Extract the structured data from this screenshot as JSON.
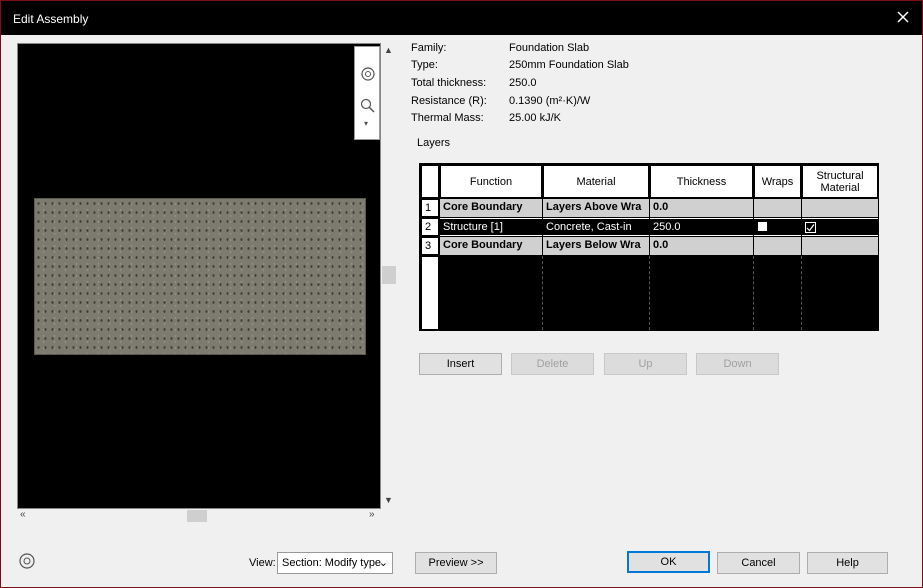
{
  "window": {
    "title": "Edit Assembly",
    "close_label": "×"
  },
  "properties": [
    {
      "label": "Family:",
      "value": "Foundation Slab"
    },
    {
      "label": "Type:",
      "value": "250mm Foundation Slab"
    },
    {
      "label": "Total thickness:",
      "value": "250.0"
    },
    {
      "label": "Resistance (R):",
      "value": "0.1390 (m²·K)/W"
    },
    {
      "label": "Thermal Mass:",
      "value": "25.00 kJ/K"
    }
  ],
  "layers": {
    "label": "Layers",
    "columns": [
      "Function",
      "Material",
      "Thickness",
      "Wraps",
      "Structural Material"
    ],
    "rows": [
      {
        "num": "1",
        "function": "Core Boundary",
        "material": "Layers Above Wra",
        "thickness": "0.0",
        "wraps": false,
        "structural": false,
        "style": "gray"
      },
      {
        "num": "2",
        "function": "Structure [1]",
        "material": "Concrete, Cast-in",
        "thickness": "250.0",
        "wraps": false,
        "structural": true,
        "style": "selected"
      },
      {
        "num": "3",
        "function": "Core Boundary",
        "material": "Layers Below Wra",
        "thickness": "0.0",
        "wraps": false,
        "structural": false,
        "style": "gray"
      }
    ]
  },
  "buttons": {
    "insert": "Insert",
    "delete": "Delete",
    "up": "Up",
    "down": "Down",
    "preview": "Preview >>",
    "ok": "OK",
    "cancel": "Cancel",
    "help": "Help"
  },
  "view": {
    "label": "View:",
    "selected": "Section: Modify type"
  }
}
